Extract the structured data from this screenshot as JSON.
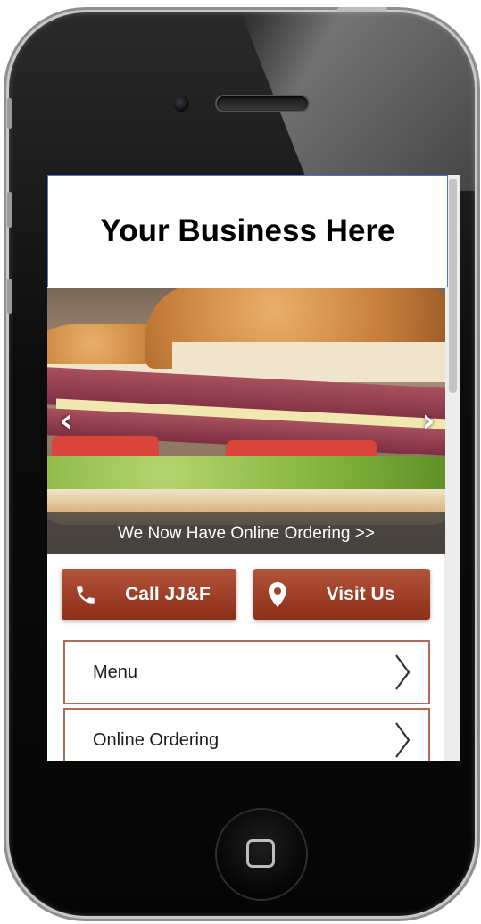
{
  "header": {
    "title": "Your Business Here"
  },
  "slider": {
    "caption": "We Now Have Online Ordering >>",
    "prev_icon": "chevron-left-icon",
    "next_icon": "chevron-right-icon"
  },
  "actions": {
    "call_label": "Call JJ&F",
    "call_icon": "phone-icon",
    "visit_label": "Visit Us",
    "visit_icon": "map-pin-icon"
  },
  "nav": {
    "items": [
      {
        "label": "Menu"
      },
      {
        "label": "Online Ordering"
      }
    ]
  },
  "colors": {
    "accent": "#9b3f27",
    "nav_border": "#b06a55",
    "header_border": "#4a78c0"
  }
}
